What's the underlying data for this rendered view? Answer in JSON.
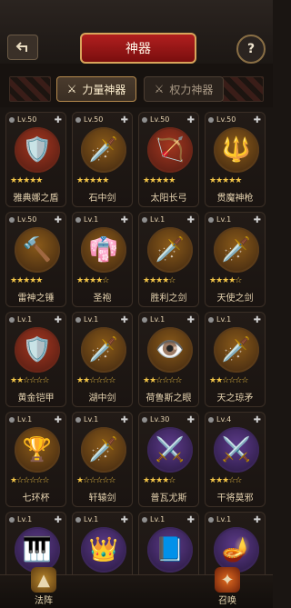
{
  "header": {
    "title": "神器"
  },
  "tabs": [
    {
      "label": "力量神器",
      "icon": "sword-icon"
    },
    {
      "label": "权力神器",
      "icon": "sword-icon"
    }
  ],
  "cards": [
    {
      "level": "Lv.50",
      "name": "雅典娜之盾",
      "stars": "★★★★★",
      "emoji": "🛡️",
      "bg": "red"
    },
    {
      "level": "Lv.50",
      "name": "石中剑",
      "stars": "★★★★★",
      "emoji": "🗡️",
      "bg": "gold"
    },
    {
      "level": "Lv.50",
      "name": "太阳长弓",
      "stars": "★★★★★",
      "emoji": "🏹",
      "bg": "red"
    },
    {
      "level": "Lv.50",
      "name": "贯魔神枪",
      "stars": "★★★★★",
      "emoji": "🔱",
      "bg": "gold"
    },
    {
      "level": "Lv.50",
      "name": "雷神之锤",
      "stars": "★★★★★",
      "emoji": "🔨",
      "bg": "gold"
    },
    {
      "level": "Lv.1",
      "name": "圣袍",
      "stars": "★★★★☆",
      "emoji": "👘",
      "bg": "gold"
    },
    {
      "level": "Lv.1",
      "name": "胜利之剑",
      "stars": "★★★★☆",
      "emoji": "🗡️",
      "bg": "gold"
    },
    {
      "level": "Lv.1",
      "name": "天使之剑",
      "stars": "★★★★☆",
      "emoji": "🗡️",
      "bg": "gold"
    },
    {
      "level": "Lv.1",
      "name": "黄金铠甲",
      "stars": "★★☆☆☆☆",
      "emoji": "🛡️",
      "bg": "red"
    },
    {
      "level": "Lv.1",
      "name": "湖中剑",
      "stars": "★★☆☆☆☆",
      "emoji": "🗡️",
      "bg": "gold"
    },
    {
      "level": "Lv.1",
      "name": "荷鲁斯之眼",
      "stars": "★★☆☆☆☆",
      "emoji": "👁️",
      "bg": "gold"
    },
    {
      "level": "Lv.1",
      "name": "天之琼矛",
      "stars": "★★☆☆☆☆",
      "emoji": "🗡️",
      "bg": "gold"
    },
    {
      "level": "Lv.1",
      "name": "七环杯",
      "stars": "★☆☆☆☆☆",
      "emoji": "🏆",
      "bg": "gold"
    },
    {
      "level": "Lv.1",
      "name": "轩辕剑",
      "stars": "★☆☆☆☆☆",
      "emoji": "🗡️",
      "bg": "gold"
    },
    {
      "level": "Lv.30",
      "name": "普瓦尤斯",
      "stars": "★★★★☆",
      "emoji": "⚔️",
      "bg": "purple"
    },
    {
      "level": "Lv.4",
      "name": "干将莫邪",
      "stars": "★★★☆☆",
      "emoji": "⚔️",
      "bg": "purple"
    },
    {
      "level": "Lv.1",
      "name": "",
      "stars": "",
      "emoji": "🎹",
      "bg": "purple"
    },
    {
      "level": "Lv.1",
      "name": "",
      "stars": "",
      "emoji": "👑",
      "bg": "purple"
    },
    {
      "level": "Lv.1",
      "name": "",
      "stars": "",
      "emoji": "📘",
      "bg": "purple"
    },
    {
      "level": "Lv.1",
      "name": "",
      "stars": "",
      "emoji": "🪔",
      "bg": "purple"
    }
  ],
  "bottom_nav": [
    {
      "label": "法阵",
      "icon": "triangle-crest-icon"
    },
    {
      "label": "召唤",
      "icon": "summon-crest-icon"
    }
  ]
}
